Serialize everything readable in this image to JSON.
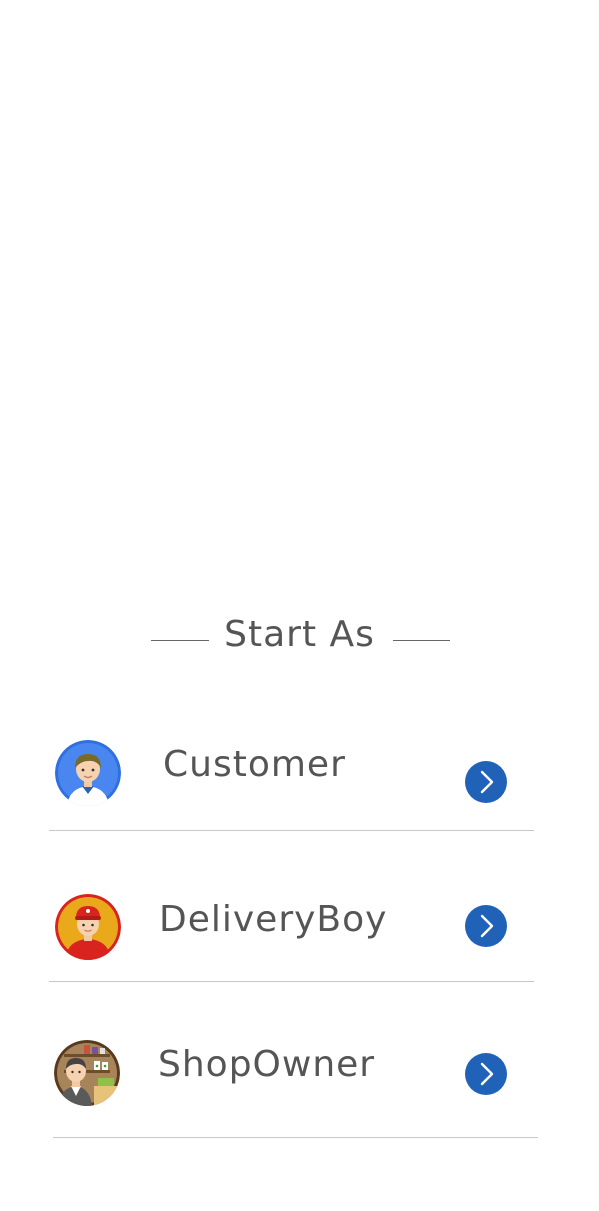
{
  "heading": {
    "title": "Start As"
  },
  "roles": [
    {
      "label": "Customer",
      "avatar_icon": "customer-avatar-icon",
      "action_icon": "chevron-right-icon"
    },
    {
      "label": "DeliveryBoy",
      "avatar_icon": "delivery-boy-avatar-icon",
      "action_icon": "chevron-right-icon"
    },
    {
      "label": "ShopOwner",
      "avatar_icon": "shop-owner-avatar-icon",
      "action_icon": "chevron-right-icon"
    }
  ],
  "colors": {
    "accent": "#1f62b8",
    "text": "#555555",
    "divider": "#c8c8c8",
    "background": "#ffffff"
  }
}
